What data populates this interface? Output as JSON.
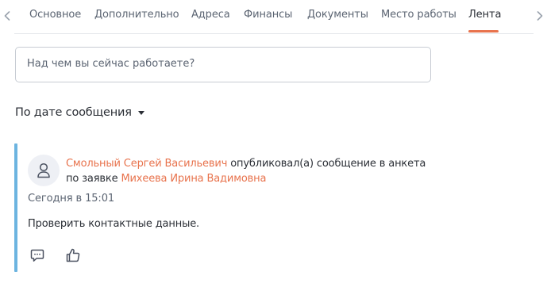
{
  "tabs": {
    "items": [
      {
        "label": "Основное"
      },
      {
        "label": "Дополнительно"
      },
      {
        "label": "Адреса"
      },
      {
        "label": "Финансы"
      },
      {
        "label": "Документы"
      },
      {
        "label": "Место работы"
      },
      {
        "label": "Лента"
      }
    ],
    "active": "Лента",
    "prev_icon": "chevron-left-icon",
    "next_icon": "chevron-right-icon"
  },
  "composer": {
    "placeholder": "Над чем вы сейчас работаете?"
  },
  "sort": {
    "label": "По дате сообщения",
    "icon": "caret-down-icon"
  },
  "post": {
    "author": "Смольный Сергей Васильевич",
    "action_text": " опубликовал(а) сообщение в анкета по заявке ",
    "target": "Михеева Ирина Вадимовна",
    "time": "Сегодня в 15:01",
    "text": "Проверить контактные данные.",
    "avatar_icon": "user-icon",
    "comment_icon": "comment-icon",
    "like_icon": "thumbs-up-icon"
  },
  "colors": {
    "accent": "#e8734d",
    "post_bar": "#6cb4e0",
    "muted": "#5b6472",
    "text": "#2b2f36"
  }
}
